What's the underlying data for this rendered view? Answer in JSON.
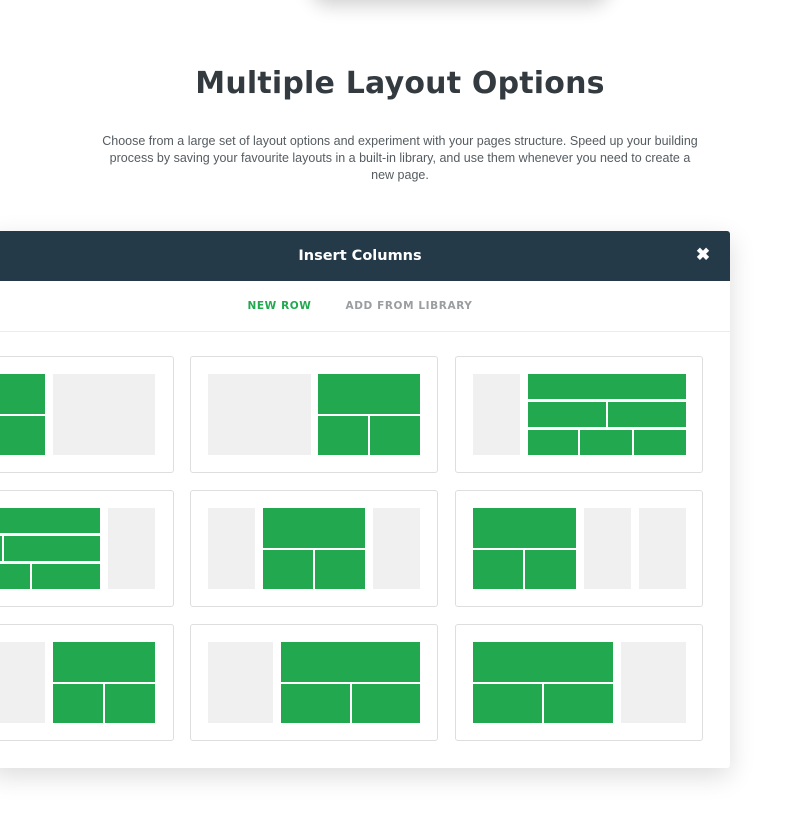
{
  "headline": "Multiple Layout Options",
  "description": "Choose from a large set of layout options and experiment with your pages structure. Speed up your building process by saving your favourite layouts in a built-in library, and use them whenever you need to create a new page.",
  "modal": {
    "title": "Insert Columns",
    "close_icon": "close-icon",
    "tabs": [
      {
        "label": "NEW ROW",
        "active": true
      },
      {
        "label": "ADD FROM LIBRARY",
        "active": false
      }
    ],
    "layout_option_count": 9
  },
  "colors": {
    "header_bg": "#253a49",
    "accent_green": "#22a94f",
    "placeholder_gray": "#f0f0f0",
    "heading_text": "#333b40"
  }
}
